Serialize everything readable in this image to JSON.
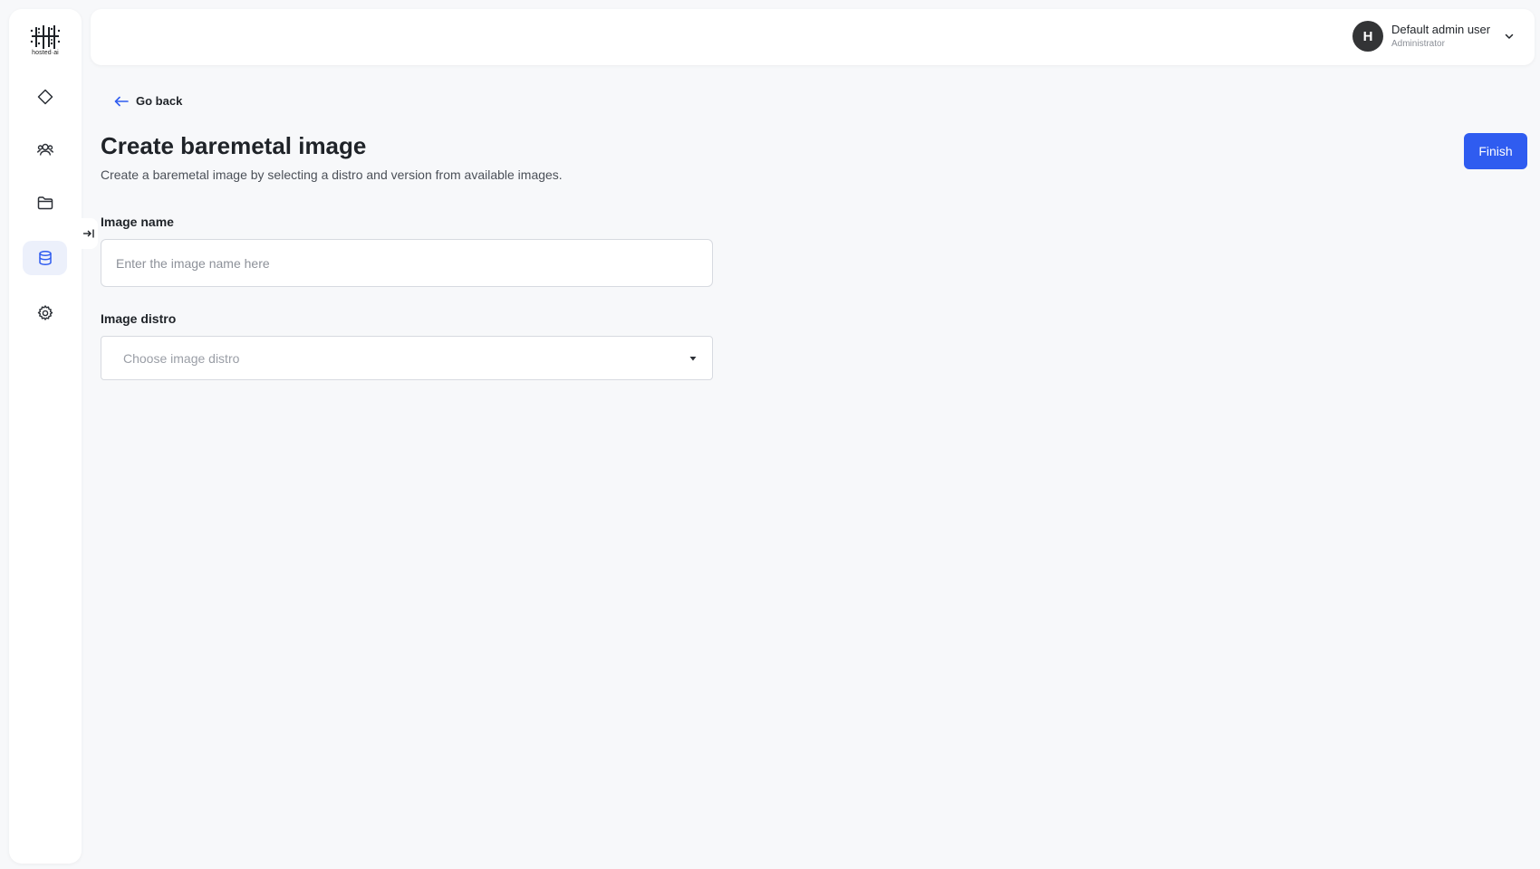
{
  "sidebar": {
    "logo_text": "hosted·ai",
    "items": [
      {
        "icon": "diamond-icon",
        "active": false
      },
      {
        "icon": "users-icon",
        "active": false
      },
      {
        "icon": "folder-icon",
        "active": false
      },
      {
        "icon": "database-icon",
        "active": true
      },
      {
        "icon": "gear-icon",
        "active": false
      }
    ],
    "collapse_icon": "expand-sidebar-icon"
  },
  "header": {
    "user": {
      "initial": "H",
      "name": "Default admin user",
      "role": "Administrator"
    }
  },
  "main": {
    "back_label": "Go back",
    "title": "Create baremetal image",
    "subtitle": "Create a baremetal image by selecting a distro and version from available images.",
    "finish_label": "Finish",
    "form": {
      "image_name": {
        "label": "Image name",
        "placeholder": "Enter the image name here",
        "value": ""
      },
      "image_distro": {
        "label": "Image distro",
        "placeholder": "Choose image distro"
      }
    }
  },
  "colors": {
    "accent": "#2f5cf0",
    "active_nav_bg": "#ecf0fb",
    "back_arrow": "#2f5cf0",
    "avatar_bg": "#333436"
  }
}
